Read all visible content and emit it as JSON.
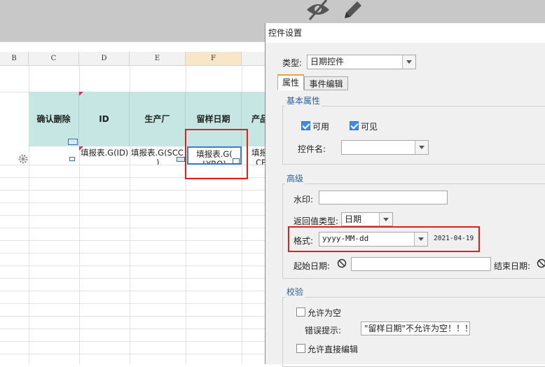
{
  "spreadsheet": {
    "columns": [
      "B",
      "C",
      "D",
      "E",
      "F"
    ],
    "headers": [
      "确认删除",
      "ID",
      "生产厂",
      "留样日期",
      "产品"
    ],
    "row_values": [
      "填报表.G(ID)",
      "填报表.G(SCC",
      "填报表.G(",
      "填报"
    ],
    "row_values_line2": [
      ")",
      "LYRQ)",
      "CP"
    ]
  },
  "dialog": {
    "title": "控件设置",
    "type_label": "类型:",
    "type_value": "日期控件",
    "tabs": [
      "属性",
      "事件编辑"
    ],
    "basic": {
      "title": "基本属性",
      "enabled_label": "可用",
      "visible_label": "可见",
      "name_label": "控件名:",
      "name_value": ""
    },
    "advanced": {
      "title": "高级",
      "watermark_label": "水印:",
      "watermark_value": "",
      "return_type_label": "返回值类型:",
      "return_type_value": "日期",
      "format_label": "格式:",
      "format_value": "yyyy-MM-dd",
      "format_preview": "2021-04-19",
      "start_date_label": "起始日期:",
      "end_date_label": "结束日期:"
    },
    "validation": {
      "title": "校验",
      "allow_empty_label": "允许为空",
      "error_label": "错误提示:",
      "error_value": "\"留样日期\"不允许为空！！！",
      "allow_direct_edit_label": "允许直接编辑"
    }
  },
  "colors": {
    "header_fill": "#c5e6e3",
    "highlight_red": "#e02020",
    "group_title_blue": "#2e5e9e",
    "checkbox_blue": "#3a8ee6"
  }
}
